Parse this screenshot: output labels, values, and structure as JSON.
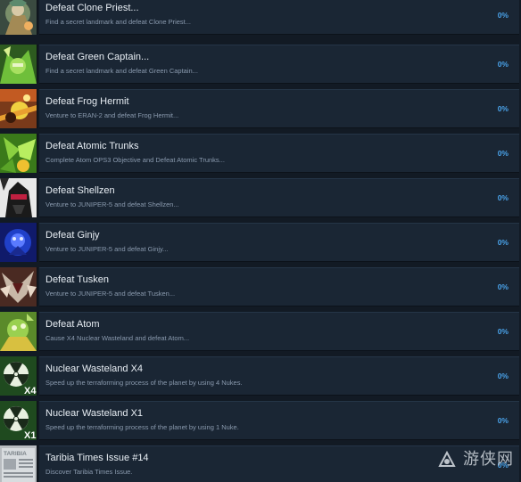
{
  "achievements": [
    {
      "title": "Defeat Clone Priest...",
      "desc": "Find a secret landmark and defeat Clone Priest...",
      "pct": "0%",
      "icon": "clone-priest-icon"
    },
    {
      "title": "Defeat Green Captain...",
      "desc": "Find a secret landmark and defeat Green Captain...",
      "pct": "0%",
      "icon": "green-captain-icon"
    },
    {
      "title": "Defeat Frog Hermit",
      "desc": "Venture to ERAN-2 and defeat Frog Hermit...",
      "pct": "0%",
      "icon": "frog-hermit-icon"
    },
    {
      "title": "Defeat Atomic Trunks",
      "desc": "Complete Atom OPS3 Objective and Defeat Atomic Trunks...",
      "pct": "0%",
      "icon": "atomic-trunks-icon"
    },
    {
      "title": "Defeat Shellzen",
      "desc": "Venture to JUNIPER-5 and defeat Shellzen...",
      "pct": "0%",
      "icon": "shellzen-icon"
    },
    {
      "title": "Defeat Ginjy",
      "desc": "Venture to JUNIPER-5 and defeat Ginjy...",
      "pct": "0%",
      "icon": "ginjy-icon"
    },
    {
      "title": "Defeat Tusken",
      "desc": "Venture to JUNIPER-5 and defeat Tusken...",
      "pct": "0%",
      "icon": "tusken-icon"
    },
    {
      "title": "Defeat Atom",
      "desc": "Cause X4 Nuclear Wasteland and defeat Atom...",
      "pct": "0%",
      "icon": "atom-icon"
    },
    {
      "title": "Nuclear Wasteland X4",
      "desc": "Speed up the terraforming process of the planet by using 4 Nukes.",
      "pct": "0%",
      "icon": "nuke-x4-icon",
      "icon_text": "X4"
    },
    {
      "title": "Nuclear Wasteland X1",
      "desc": "Speed up the terraforming process of the planet by using 1 Nuke.",
      "pct": "0%",
      "icon": "nuke-x1-icon",
      "icon_text": "X1"
    },
    {
      "title": "Taribia Times Issue #14",
      "desc": "Discover Taribia Times Issue.",
      "pct": "0%",
      "icon": "newspaper-icon",
      "icon_text": "TARIBIA"
    }
  ],
  "watermark": {
    "text": "游侠网",
    "icon": "ali213-logo-icon"
  },
  "colors": {
    "background": "#121a24",
    "card": "#1a2634",
    "title": "#e8eef4",
    "description": "#8a9aae",
    "percent": "#4aa3ea"
  }
}
